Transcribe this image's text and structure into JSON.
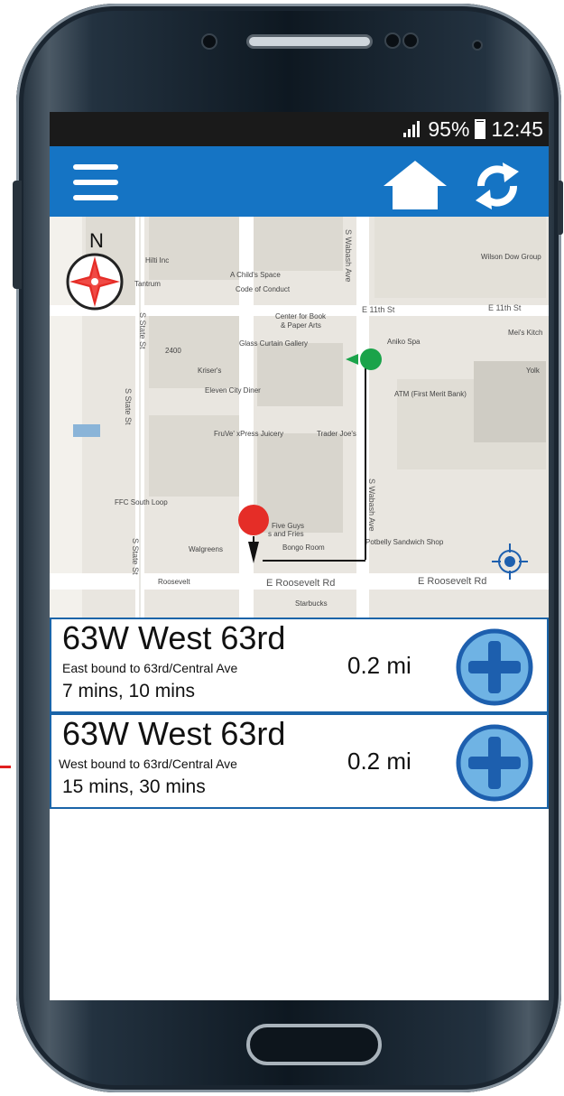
{
  "device": {
    "name": "Android smartphone"
  },
  "status_bar": {
    "battery": "95%",
    "time": "12:45",
    "icons": [
      "signal-icon",
      "battery-icon"
    ]
  },
  "app_bar": {
    "color": "#1574c4",
    "icons": [
      "menu-icon",
      "home-icon",
      "refresh-icon"
    ]
  },
  "map": {
    "compass_label": "N",
    "streets": [
      "S Wabash Ave",
      "E 11th St",
      "E 11th St",
      "S State St",
      "S State St",
      "S State St",
      "E Roosevelt Rd",
      "E Roosevelt Rd",
      "S Wabash Ave"
    ],
    "places": [
      "Hilti Inc",
      "Tantrum",
      "A Child's Space",
      "Code of Conduct",
      "Center for Book",
      "& Paper Arts",
      "Glass Curtain Gallery",
      "Kriser's",
      "Eleven City Diner",
      "FruVe' xPress Juicery",
      "Trader Joe's",
      "Aniko Spa",
      "ATM (First Merit Bank)",
      "Wilson Dow Group",
      "Mei's Kitch",
      "Yolk",
      "FFC South Loop",
      "Five Guys",
      "s and Fries",
      "Walgreens",
      "Bongo Room",
      "Potbelly Sandwich Shop",
      "Roosevelt",
      "Starbucks",
      "2400"
    ],
    "origin_marker_color": "#e52d27",
    "destination_marker_color": "#1aa34a"
  },
  "routes": [
    {
      "name": "63W West 63rd",
      "direction": "East bound to 63rd/Central Ave",
      "times": "7 mins, 10 mins",
      "distance": "0.2 mi",
      "action_icon": "add-icon"
    },
    {
      "name": "63W West 63rd",
      "direction": "West bound to 63rd/Central Ave",
      "times": "15 mins, 30 mins",
      "distance": "0.2 mi",
      "action_icon": "add-icon"
    }
  ]
}
